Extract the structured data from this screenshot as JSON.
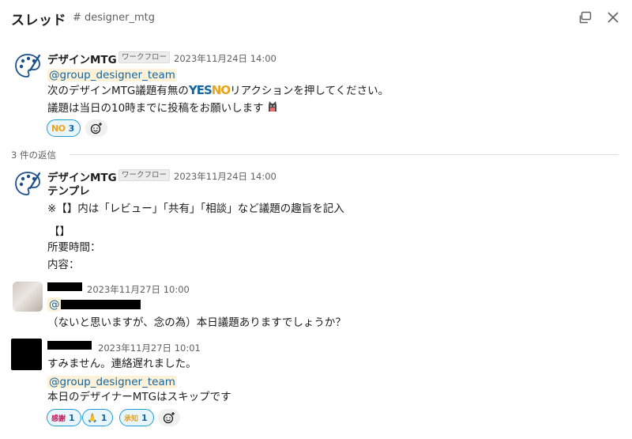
{
  "header": {
    "title": "スレッド",
    "channel": "# designer_mtg"
  },
  "parent": {
    "sender": "デザインMTG",
    "badge": "ワークフロー",
    "timestamp": "2023年11月24日 14:00",
    "mention": "@group_designer_team",
    "line1_pre": "次のデザインMTG議題有無の",
    "yes": "YES",
    "no": "NO",
    "line1_post": "リアクションを押してください。",
    "line2": "議題は当日の10時までに投稿をお願いします",
    "reactions": [
      {
        "emoji": "NO",
        "count": "3"
      }
    ]
  },
  "replies_count": "3 件の返信",
  "reply1": {
    "sender": "デザインMTG",
    "badge": "ワークフロー",
    "timestamp": "2023年11月24日 14:00",
    "title": "テンプレ",
    "line1": "※【】内は「レビュー」「共有」「相談」など議題の趣旨を記入",
    "line2": "【】",
    "line3": "所要時間：",
    "line4": "内容："
  },
  "reply2": {
    "timestamp": "2023年11月27日 10:00",
    "mention_prefix": "@",
    "line1": "（ないと思いますが、念の為）本日議題ありますでしょうか？"
  },
  "reply3": {
    "timestamp": "2023年11月27日 10:01",
    "line1": "すみません。連絡遅れました。",
    "mention": "@group_designer_team",
    "line2": "本日のデザイナーMTGはスキップです",
    "reactions": [
      {
        "emoji": "感謝",
        "count": "1"
      },
      {
        "emoji": "🙏",
        "count": "1"
      },
      {
        "emoji": "承知",
        "count": "1"
      }
    ]
  },
  "colors": {
    "link": "#1264a3",
    "mention_bg": "#fdf2d7",
    "reaction_border": "#1d9bd1",
    "yes": "#1264a3",
    "no": "#e8a41c"
  },
  "icons": {
    "popout": "popout-icon",
    "close": "close-icon",
    "add_reaction": "add-reaction-icon",
    "avatar_workflow": "palette-icon"
  }
}
